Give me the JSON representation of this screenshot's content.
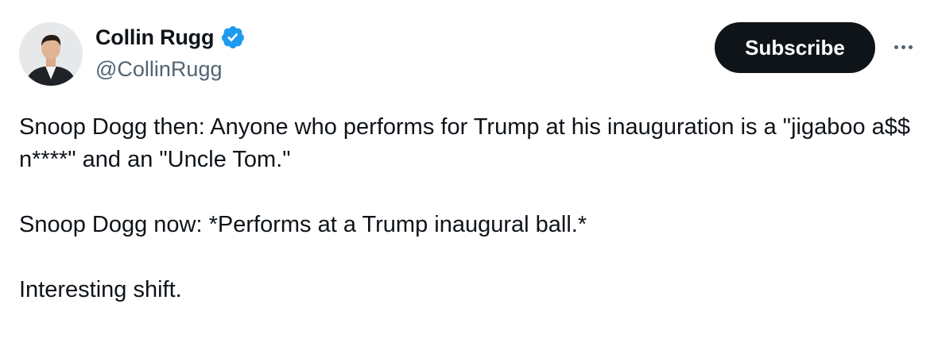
{
  "author": {
    "display_name": "Collin Rugg",
    "handle": "@CollinRugg",
    "verified": true,
    "avatar_icon": "profile-photo"
  },
  "actions": {
    "subscribe_label": "Subscribe",
    "more_icon": "more-options-icon"
  },
  "tweet": {
    "paragraphs": [
      "Snoop Dogg then: Anyone who performs for Trump at his inauguration is a \"jigaboo a$$ n****\" and an \"Uncle Tom.\"",
      "Snoop Dogg now: *Performs at a Trump inaugural ball.*",
      "Interesting shift."
    ]
  },
  "colors": {
    "text_primary": "#0f1419",
    "text_secondary": "#536471",
    "verified_blue": "#1d9bf0",
    "button_bg": "#0f1419",
    "button_text": "#ffffff"
  }
}
